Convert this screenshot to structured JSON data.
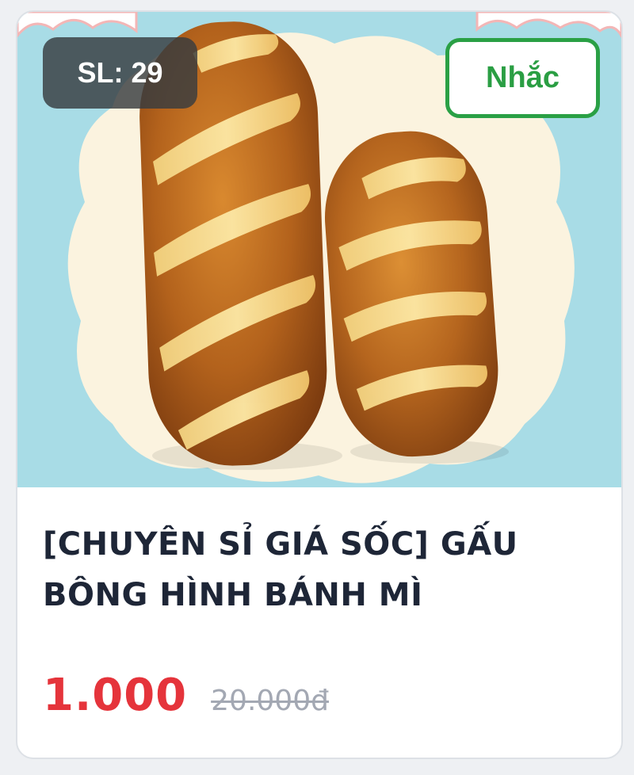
{
  "product": {
    "stock_label": "SL: 29",
    "remind_label": "Nhắc",
    "title": "[CHUYÊN SỈ GIÁ SỐC] GẤU BÔNG HÌNH BÁNH MÌ",
    "price": "1.000",
    "original_price": "20.000đ",
    "image_icon": "bread-pillow-product-image"
  },
  "colors": {
    "price": "#e5343b",
    "remind_accent": "#2aa045",
    "title": "#1e2637",
    "old_price": "#a3a8b3",
    "image_background": "#a8dce6"
  }
}
